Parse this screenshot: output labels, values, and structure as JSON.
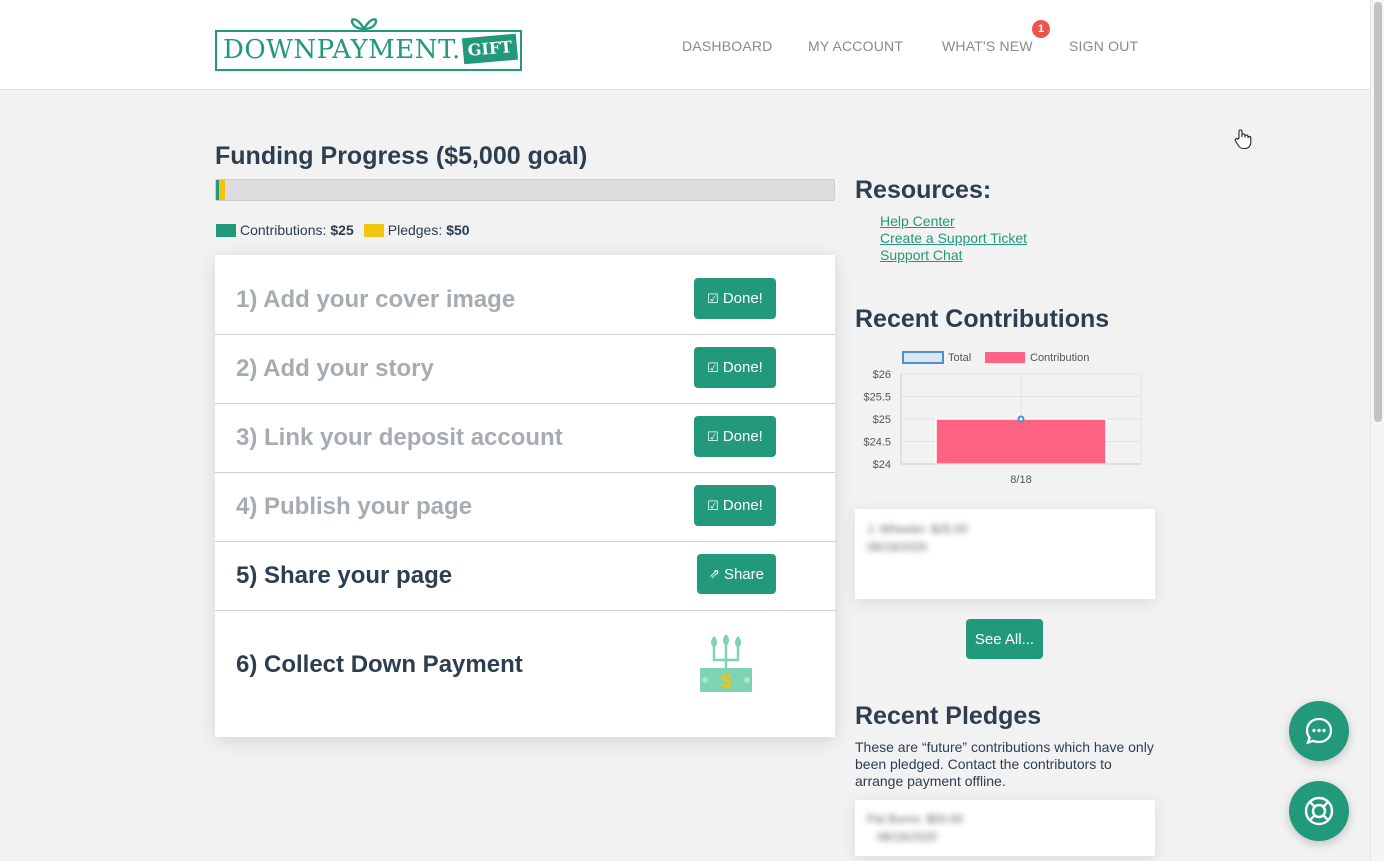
{
  "header": {
    "logo_text": "DOWNPAYMENT.",
    "logo_tag": "GIFT",
    "nav": [
      {
        "label": "DASHBOARD"
      },
      {
        "label": "MY ACCOUNT"
      },
      {
        "label": "WHAT'S NEW",
        "badge": "1"
      },
      {
        "label": "SIGN OUT"
      }
    ]
  },
  "funding": {
    "title": "Funding Progress ($5,000 goal)",
    "goal": 5000,
    "contributions_value": 25,
    "pledges_value": 50,
    "legend": {
      "contributions_label": "Contributions:",
      "contributions_amount": "$25",
      "pledges_label": "Pledges:",
      "pledges_amount": "$50"
    },
    "colors": {
      "contributions": "#23997b",
      "pledges": "#f1c40f",
      "track": "#dcdcdc"
    }
  },
  "steps": [
    {
      "label": "1) Add your cover image",
      "state": "done",
      "button": "Done!",
      "button_icon": "check-square-icon"
    },
    {
      "label": "2) Add your story",
      "state": "done",
      "button": "Done!",
      "button_icon": "check-square-icon"
    },
    {
      "label": "3) Link your deposit account",
      "state": "done",
      "button": "Done!",
      "button_icon": "check-square-icon"
    },
    {
      "label": "4) Publish your page",
      "state": "done",
      "button": "Done!",
      "button_icon": "check-square-icon"
    },
    {
      "label": "5) Share your page",
      "state": "todo",
      "button": "Share",
      "button_icon": "share-icon"
    },
    {
      "label": "6) Collect Down Payment",
      "state": "todo",
      "icon": "money-plant-icon"
    }
  ],
  "resources": {
    "title": "Resources:",
    "links": [
      "Help Center",
      "Create a Support Ticket",
      "Support Chat"
    ]
  },
  "recent_contributions": {
    "title": "Recent Contributions",
    "see_all": "See All...",
    "chart_data": {
      "type": "bar",
      "categories": [
        "8/18"
      ],
      "series": [
        {
          "name": "Total",
          "type": "line",
          "values": [
            25
          ],
          "color": "#4a90d9"
        },
        {
          "name": "Contribution",
          "type": "bar",
          "values": [
            25
          ],
          "color": "#ff6384"
        }
      ],
      "yticks": [
        "$26",
        "$25.5",
        "$25",
        "$24.5",
        "$24"
      ],
      "ylim": [
        24,
        26
      ],
      "legend": "top",
      "grid": true
    },
    "blurred_entry": {
      "line1": "J. Wheeler: $25.00",
      "line2": "08/18/2020"
    }
  },
  "recent_pledges": {
    "title": "Recent Pledges",
    "description": "These are “future” contributions which have only been pledged. Contact the contributors to arrange payment offline.",
    "blurred_entry": {
      "line1": "Pat Burns: $50.00",
      "line2": "08/18/2020"
    }
  },
  "widgets": [
    {
      "icon": "chat-bubble-icon"
    },
    {
      "icon": "lifebuoy-icon"
    }
  ]
}
